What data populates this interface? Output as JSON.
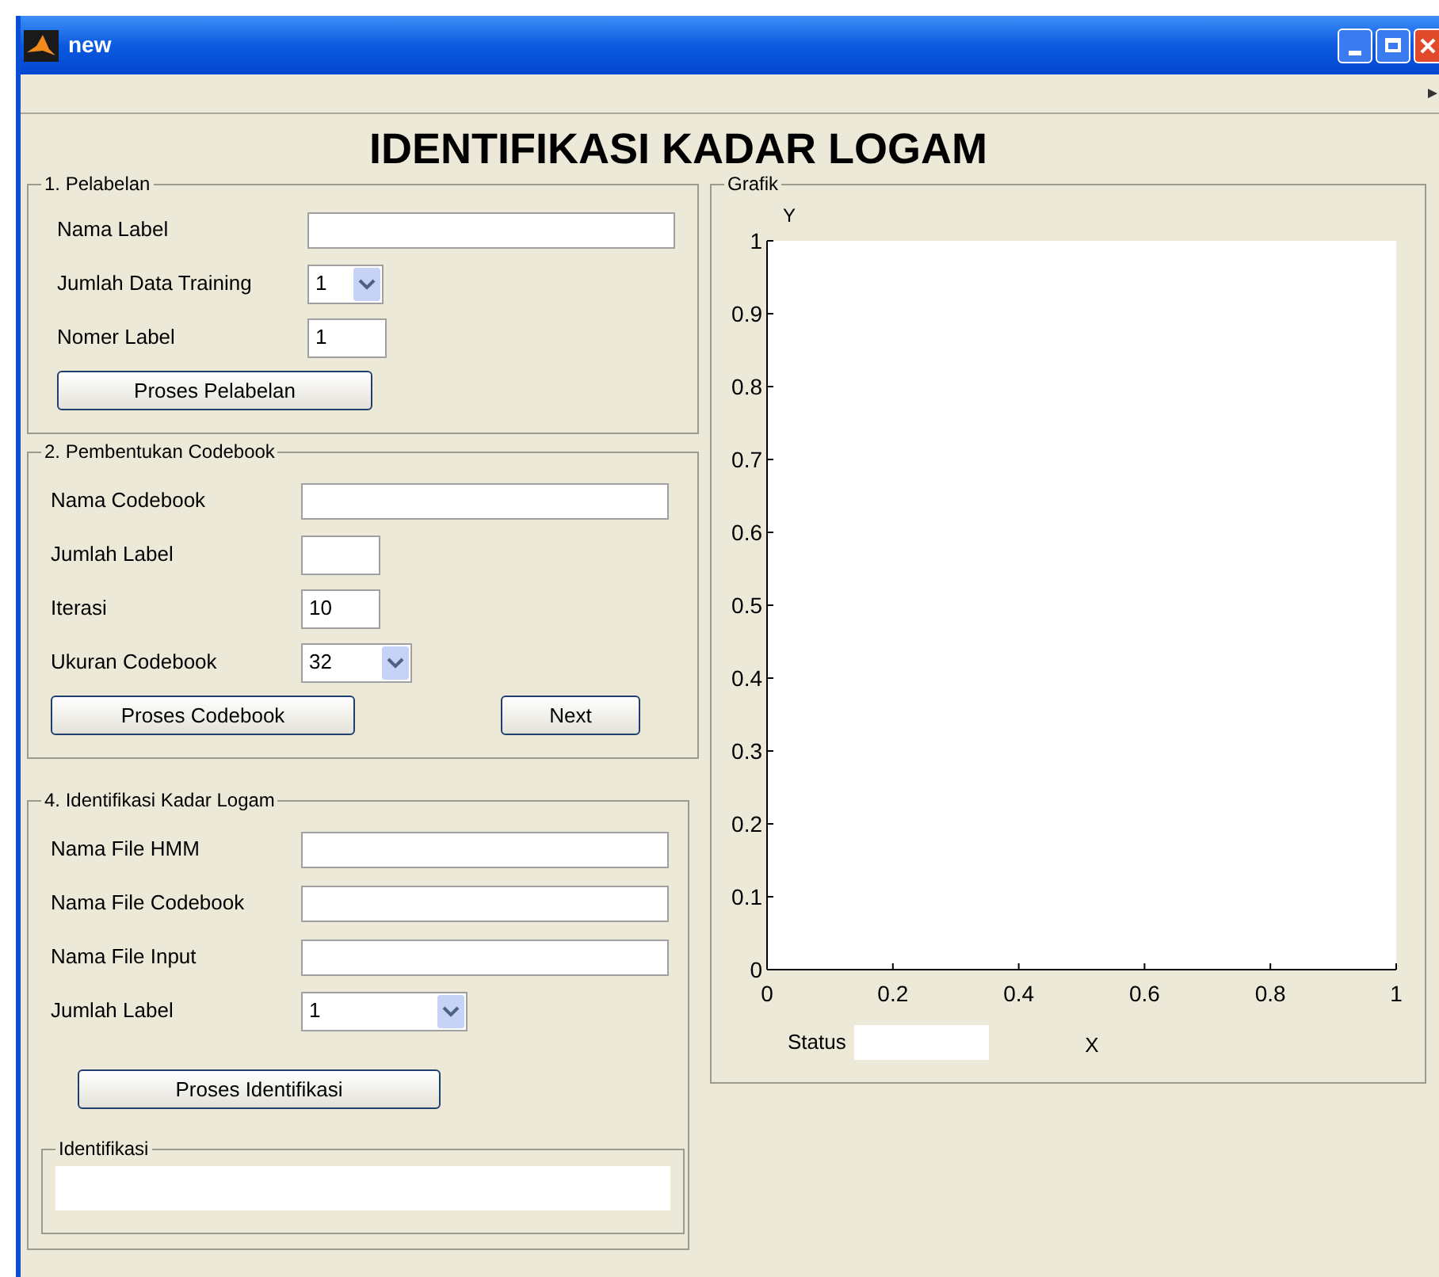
{
  "window": {
    "title": "new"
  },
  "heading": "IDENTIFIKASI KADAR LOGAM",
  "sections": [
    {
      "title": "1. Pelabelan",
      "fields": [
        {
          "label": "Nama Label",
          "kind": "textbox"
        },
        {
          "label": "Jumlah Data Training",
          "kind": "dropdown",
          "value": "1"
        },
        {
          "label": "Nomer Label",
          "kind": "numberbox",
          "value": "1"
        }
      ],
      "buttons": [
        "Proses Pelabelan"
      ]
    },
    {
      "title": "2. Pembentukan Codebook",
      "fields": [
        {
          "label": "Nama Codebook",
          "kind": "textbox"
        },
        {
          "label": "Jumlah Label",
          "kind": "numberbox"
        },
        {
          "label": "Iterasi",
          "kind": "numberbox",
          "value": "10"
        },
        {
          "label": "Ukuran Codebook",
          "kind": "dropdown",
          "value": "32"
        }
      ],
      "buttons": [
        "Proses Codebook",
        "Next"
      ]
    },
    {
      "title": "4. Identifikasi Kadar Logam",
      "fields": [
        {
          "label": "Nama File HMM",
          "kind": "textbox"
        },
        {
          "label": "Nama File Codebook",
          "kind": "textbox"
        },
        {
          "label": "Nama File Input",
          "kind": "textbox"
        },
        {
          "label": "Jumlah Label",
          "kind": "dropdown",
          "value": "1"
        }
      ],
      "buttons": [
        "Proses Identifikasi"
      ],
      "output": {
        "title": "Identifikasi"
      }
    }
  ],
  "graph": {
    "title": "Grafik",
    "status_label": "Status",
    "chart_data": {
      "type": "line",
      "xlabel": "X",
      "ylabel": "Y",
      "xlim": [
        0,
        1
      ],
      "ylim": [
        0,
        1
      ],
      "xticks": [
        0,
        0.2,
        0.4,
        0.6,
        0.8,
        1
      ],
      "yticks": [
        0,
        0.1,
        0.2,
        0.3,
        0.4,
        0.5,
        0.6,
        0.7,
        0.8,
        0.9,
        1
      ]
    }
  }
}
